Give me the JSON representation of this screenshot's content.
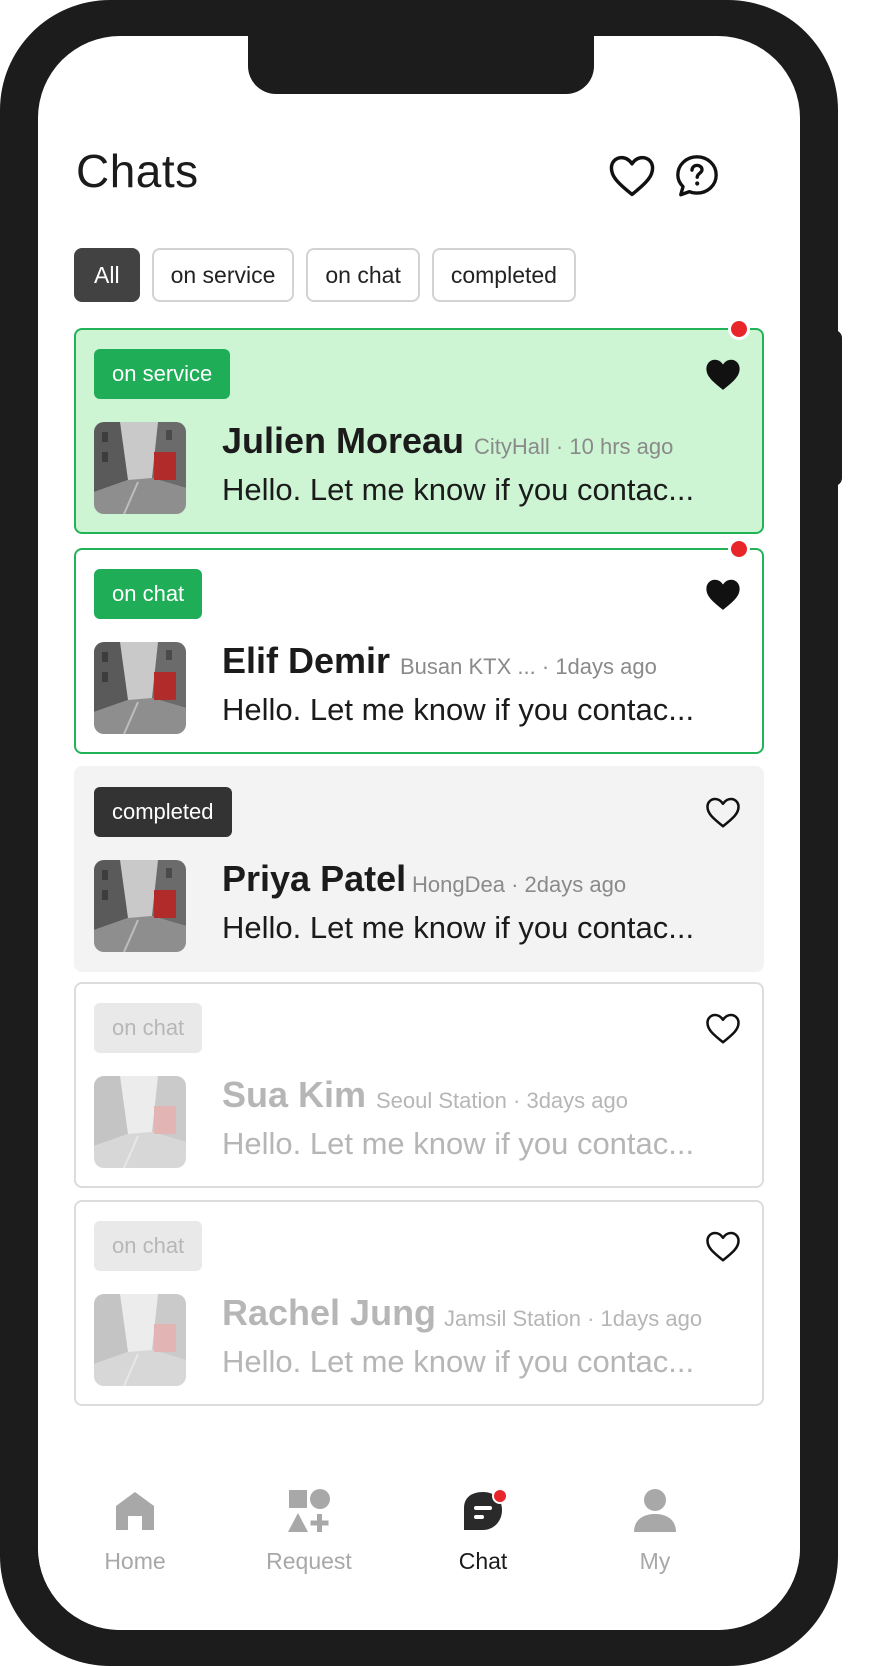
{
  "header": {
    "title": "Chats",
    "favorites_icon": "heart-outline-icon",
    "help_icon": "help-bubble-icon"
  },
  "filters": [
    {
      "label": "All",
      "active": true
    },
    {
      "label": "on service",
      "active": false
    },
    {
      "label": "on chat",
      "active": false
    },
    {
      "label": "completed",
      "active": false
    }
  ],
  "chats": [
    {
      "status": "on service",
      "name": "Julien Moreau",
      "location": "CityHall",
      "time": "10 hrs ago",
      "message": "Hello. Let me know if you contac...",
      "favorite": true,
      "unread": true
    },
    {
      "status": "on chat",
      "name": "Elif Demir",
      "location": "Busan KTX ...",
      "time": "1days ago",
      "message": "Hello. Let me know if you contac...",
      "favorite": true,
      "unread": true
    },
    {
      "status": "completed",
      "name": "Priya Patel",
      "location": "HongDea",
      "time": "2days ago",
      "message": "Hello. Let me know if you contac...",
      "favorite": false,
      "unread": false
    },
    {
      "status": "on chat",
      "name": "Sua Kim",
      "location": "Seoul Station",
      "time": "3days ago",
      "message": "Hello. Let me know if you contac...",
      "favorite": false,
      "unread": false
    },
    {
      "status": "on chat",
      "name": "Rachel Jung",
      "location": "Jamsil Station",
      "time": "1days ago",
      "message": "Hello. Let me know if you contac...",
      "favorite": false,
      "unread": false
    }
  ],
  "meta_separator": "·",
  "nav": [
    {
      "label": "Home",
      "icon": "home-icon",
      "active": false
    },
    {
      "label": "Request",
      "icon": "shapes-icon",
      "active": false
    },
    {
      "label": "Chat",
      "icon": "chat-icon",
      "active": true
    },
    {
      "label": "My",
      "icon": "person-icon",
      "active": false
    }
  ],
  "colors": {
    "green": "#1fad57",
    "green_bg": "#cdf5d4",
    "dark": "#333333",
    "unread_dot": "#e8262a",
    "frame": "#1c1c1c"
  }
}
